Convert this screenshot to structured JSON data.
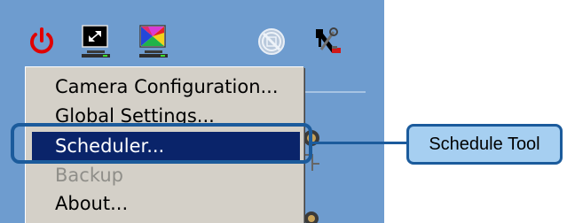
{
  "toolbar": {
    "buttons": [
      {
        "name": "power-icon"
      },
      {
        "name": "monitor-fit-icon"
      },
      {
        "name": "color-monitor-icon"
      },
      {
        "name": "no-record-icon"
      },
      {
        "name": "network-tools-icon"
      }
    ]
  },
  "menu": {
    "items": [
      {
        "label": "Camera Configuration...",
        "state": "normal"
      },
      {
        "label": "Global Settings...",
        "state": "normal"
      },
      {
        "label": "Scheduler...",
        "state": "selected"
      },
      {
        "label": "Backup",
        "state": "disabled"
      },
      {
        "label": "About...",
        "state": "normal"
      }
    ]
  },
  "callout": {
    "label": "Schedule Tool"
  },
  "colors": {
    "app_background": "#6e9ccf",
    "menu_background": "#d4d0c8",
    "menu_selection": "#0a246a",
    "callout_border": "#1b5b9c",
    "callout_fill": "#a6cff1",
    "power_red": "#e00000"
  }
}
